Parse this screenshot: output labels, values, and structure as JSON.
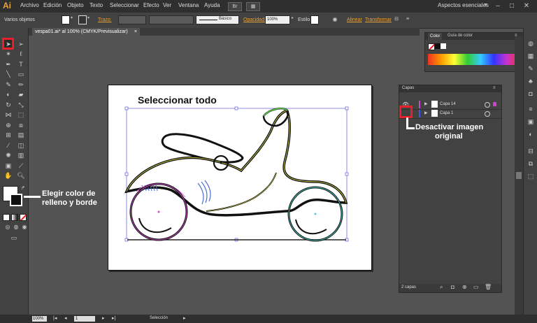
{
  "app": {
    "logo": "Ai",
    "menu": [
      "Archivo",
      "Edición",
      "Objeto",
      "Texto",
      "Seleccionar",
      "Efecto",
      "Ver",
      "Ventana",
      "Ayuda"
    ],
    "bridge_label": "Br",
    "workspace": "Aspectos esenciales"
  },
  "control_bar": {
    "selection_label": "Varios objetos",
    "stroke_label": "Trazo:",
    "brush_label": "Básico",
    "opacity_label": "Opacidad:",
    "opacity_value": "100%",
    "style_label": "Estilo:",
    "align_label": "Alinear",
    "transform_label": "Transformar"
  },
  "document_tab": {
    "title": "vespa01.ai* al 100% (CMYK/Previsualizar)",
    "close": "×"
  },
  "artboard": {
    "heading": "Seleccionar todo"
  },
  "annotations": {
    "fill_stroke": [
      "Elegir color de",
      "relleno y borde"
    ],
    "deactivate": [
      "Desactivar imagen",
      "original"
    ]
  },
  "color_panel": {
    "tabs": [
      "Color",
      "Guía de color"
    ]
  },
  "layers_panel": {
    "title": "Capas",
    "layers": [
      {
        "name": "Capa 14",
        "color": "#cc44cc"
      },
      {
        "name": "Capa 1",
        "color": "#4455ee"
      }
    ],
    "footer": "2 capas"
  },
  "status_bar": {
    "zoom": "100%",
    "page": "1",
    "tool": "Selección"
  },
  "colors": {
    "accent": "#e8a33a",
    "highlight_red": "#e8202a",
    "selection_blue": "#5b5bd6"
  }
}
